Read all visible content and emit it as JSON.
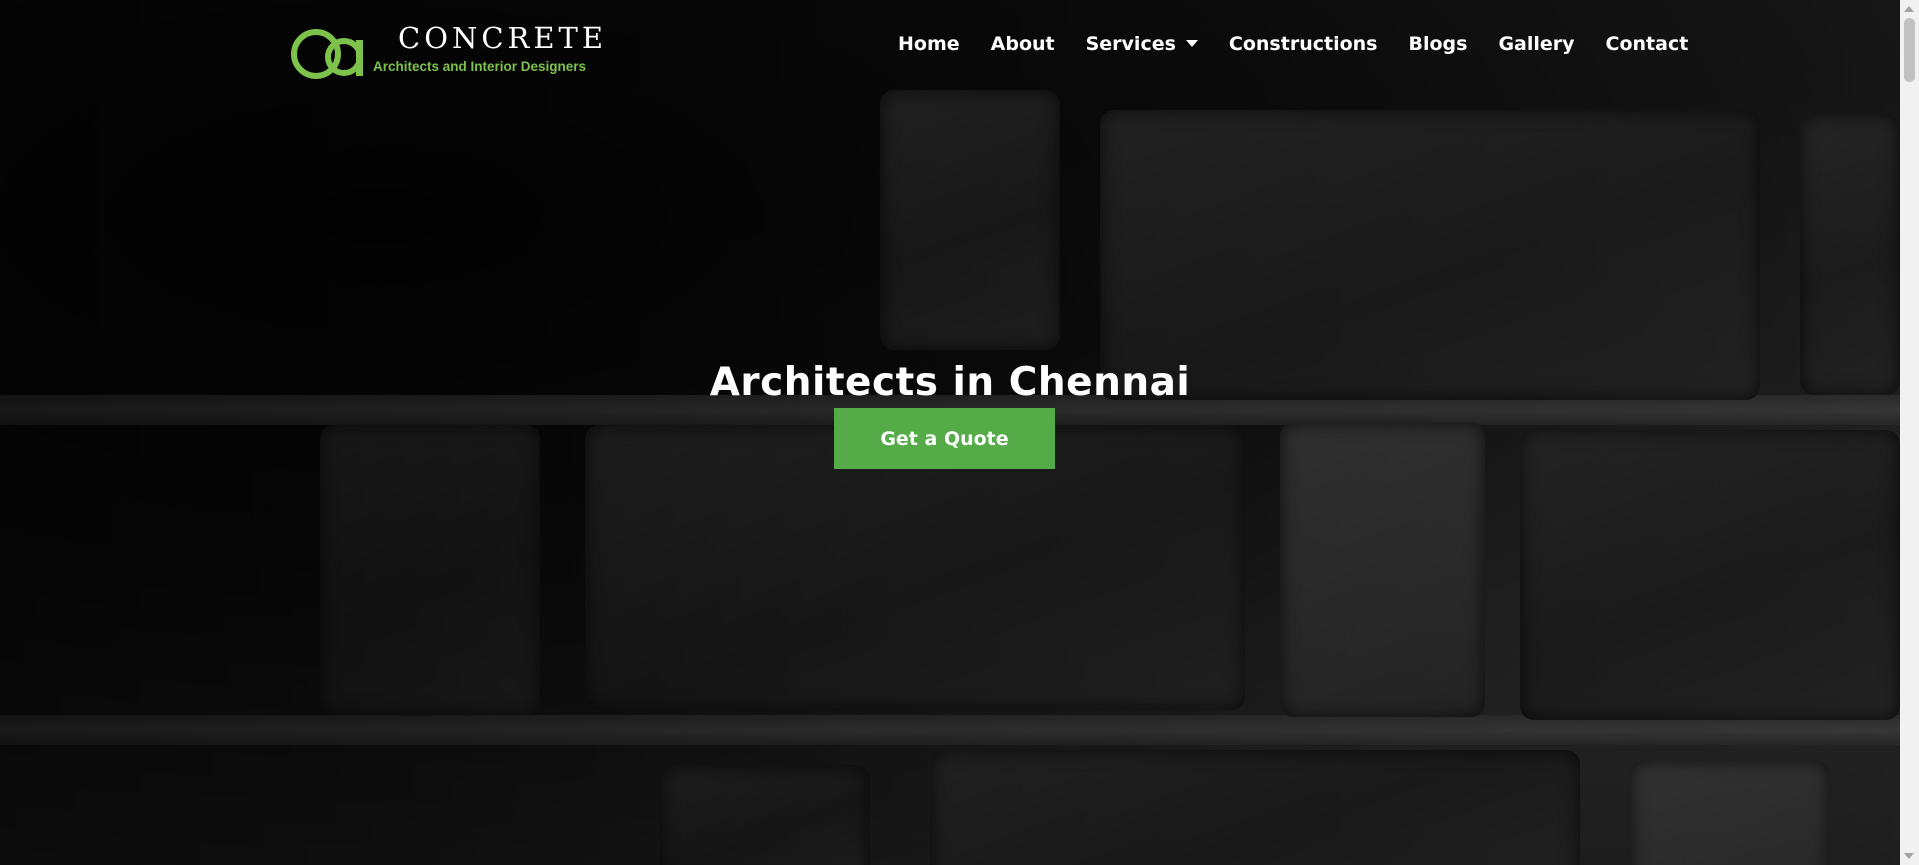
{
  "header": {
    "logo": {
      "title": "CONCRETE",
      "subtitle": "Architects and Interior Designers",
      "brand_color": "#7dc24b"
    },
    "nav": [
      {
        "label": "Home"
      },
      {
        "label": "About"
      },
      {
        "label": "Services",
        "has_dropdown": true
      },
      {
        "label": "Constructions"
      },
      {
        "label": "Blogs"
      },
      {
        "label": "Gallery"
      },
      {
        "label": "Contact"
      }
    ]
  },
  "hero": {
    "title": "Architects in Chennai",
    "cta_label": "Get a Quote",
    "cta_color": "#55ab48",
    "background": "dark brick wall"
  }
}
